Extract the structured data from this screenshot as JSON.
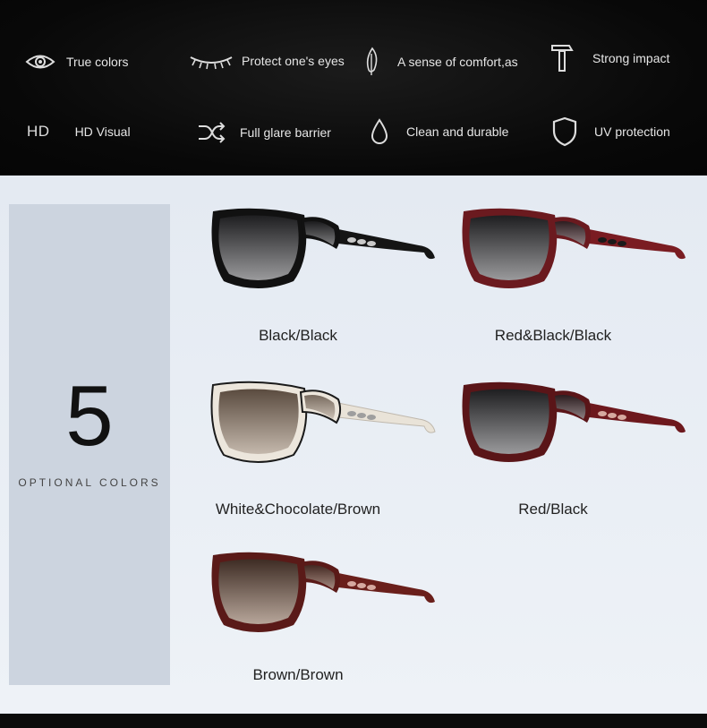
{
  "features": {
    "row1": [
      {
        "label": "True colors",
        "icon": "eye-icon"
      },
      {
        "label": "Protect one's eyes",
        "icon": "eyelash-icon"
      },
      {
        "label": "A sense of comfort,as",
        "icon": "feather-icon"
      },
      {
        "label": "Strong impact",
        "icon": "hammer-icon"
      }
    ],
    "row2": [
      {
        "label": "HD Visual",
        "icon": "hd-icon",
        "icon_text": "HD"
      },
      {
        "label": "Full glare barrier",
        "icon": "shuffle-icon"
      },
      {
        "label": "Clean and durable",
        "icon": "drop-icon"
      },
      {
        "label": "UV protection",
        "icon": "shield-icon"
      }
    ]
  },
  "sidebar": {
    "count": "5",
    "caption": "OPTIONAL COLORS"
  },
  "products": [
    {
      "label": "Black/Black",
      "frame": "#111111",
      "lens": "#2e2e30",
      "temple": "#151515"
    },
    {
      "label": "Red&Black/Black",
      "frame": "#6b1a1f",
      "lens": "#2c2c2e",
      "temple": "#7a1c22"
    },
    {
      "label": "White&Chocolate/Brown",
      "frame": "#ece6dc",
      "lens": "#7a6a5c",
      "temple": "#e9e3d8"
    },
    {
      "label": "Red/Black",
      "frame": "#5a1518",
      "lens": "#2a2a2c",
      "temple": "#6d181d"
    },
    {
      "label": "Brown/Brown",
      "frame": "#5a1a18",
      "lens": "#6b5446",
      "temple": "#6a1f1b"
    }
  ],
  "colors": {
    "top_bg": "#0a0a0a",
    "main_bg": "#e9eef5",
    "sidebar_bg": "#ccd4df"
  }
}
